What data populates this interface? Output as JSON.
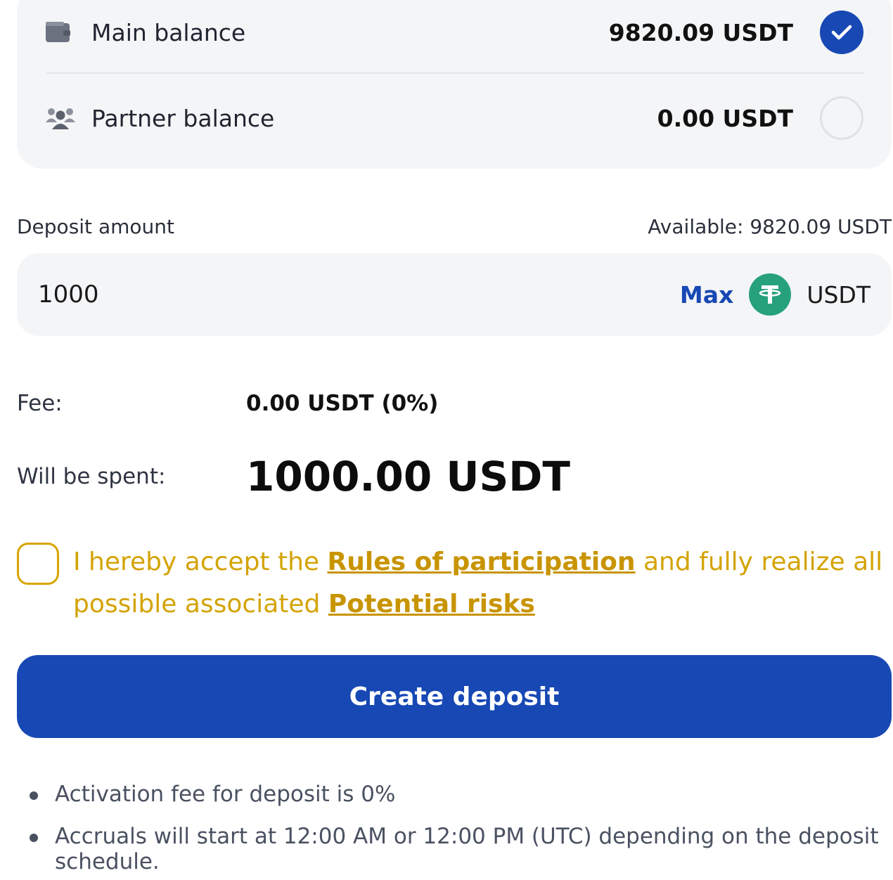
{
  "balances": {
    "main": {
      "label": "Main balance",
      "amount": "9820.09 USDT",
      "selected": true
    },
    "partner": {
      "label": "Partner balance",
      "amount": "0.00 USDT",
      "selected": false
    }
  },
  "deposit": {
    "label": "Deposit amount",
    "available": "Available: 9820.09 USDT",
    "amount_value": "1000",
    "max_label": "Max",
    "currency": "USDT"
  },
  "summary": {
    "fee_label": "Fee:",
    "fee_value": "0.00 USDT (0%)",
    "spent_label": "Will be spent:",
    "spent_value": "1000.00 USDT"
  },
  "agreement": {
    "text_1": "I hereby accept the ",
    "rules_link": "Rules of participation",
    "text_2": " and fully realize all possible associated ",
    "risks_link": "Potential risks"
  },
  "actions": {
    "create_label": "Create deposit"
  },
  "notes": [
    "Activation fee for deposit is 0%",
    "Accruals will start at 12:00 AM or 12:00 PM (UTC) depending on the deposit schedule."
  ],
  "colors": {
    "primary": "#1748b4",
    "warning": "#d4a304",
    "tether": "#26a17b",
    "panel": "#f4f5f7"
  }
}
